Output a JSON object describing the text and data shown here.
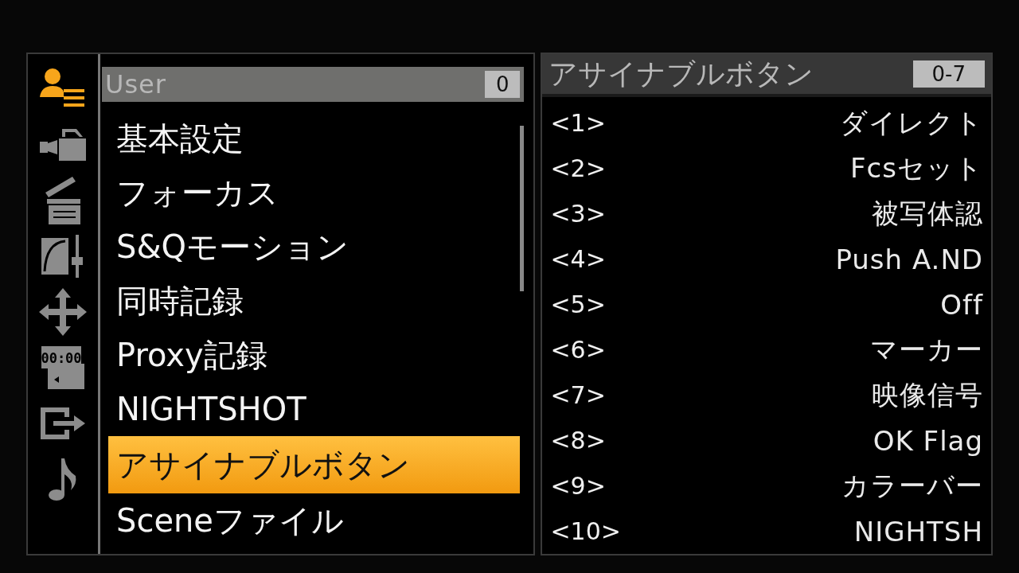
{
  "categories": [
    {
      "kind": "user",
      "selected": true
    },
    {
      "kind": "camera",
      "selected": false
    },
    {
      "kind": "clapper",
      "selected": false
    },
    {
      "kind": "curve",
      "selected": false
    },
    {
      "kind": "move",
      "selected": false
    },
    {
      "kind": "timecode",
      "selected": false,
      "label": "00:00"
    },
    {
      "kind": "output",
      "selected": false
    },
    {
      "kind": "audio",
      "selected": false
    }
  ],
  "menu": {
    "title": "User",
    "page": "0",
    "items": [
      {
        "label": "基本設定",
        "selected": false
      },
      {
        "label": "フォーカス",
        "selected": false
      },
      {
        "label": "S&Qモーション",
        "selected": false
      },
      {
        "label": "同時記録",
        "selected": false
      },
      {
        "label": "Proxy記録",
        "selected": false
      },
      {
        "label": "NIGHTSHOT",
        "selected": false
      },
      {
        "label": "アサイナブルボタン",
        "selected": true
      },
      {
        "label": "Sceneファイル",
        "selected": false
      }
    ]
  },
  "detail": {
    "title": "アサイナブルボタン",
    "range": "0-7",
    "rows": [
      {
        "key": "<1>",
        "value": "ダイレクト"
      },
      {
        "key": "<2>",
        "value": "Fcsセット"
      },
      {
        "key": "<3>",
        "value": "被写体認"
      },
      {
        "key": "<4>",
        "value": "Push A.ND"
      },
      {
        "key": "<5>",
        "value": "Off"
      },
      {
        "key": "<6>",
        "value": "マーカー"
      },
      {
        "key": "<7>",
        "value": "映像信号"
      },
      {
        "key": "<8>",
        "value": "OK Flag"
      },
      {
        "key": "<9>",
        "value": "カラーバー"
      },
      {
        "key": "<10>",
        "value": "NIGHTSH"
      }
    ]
  }
}
